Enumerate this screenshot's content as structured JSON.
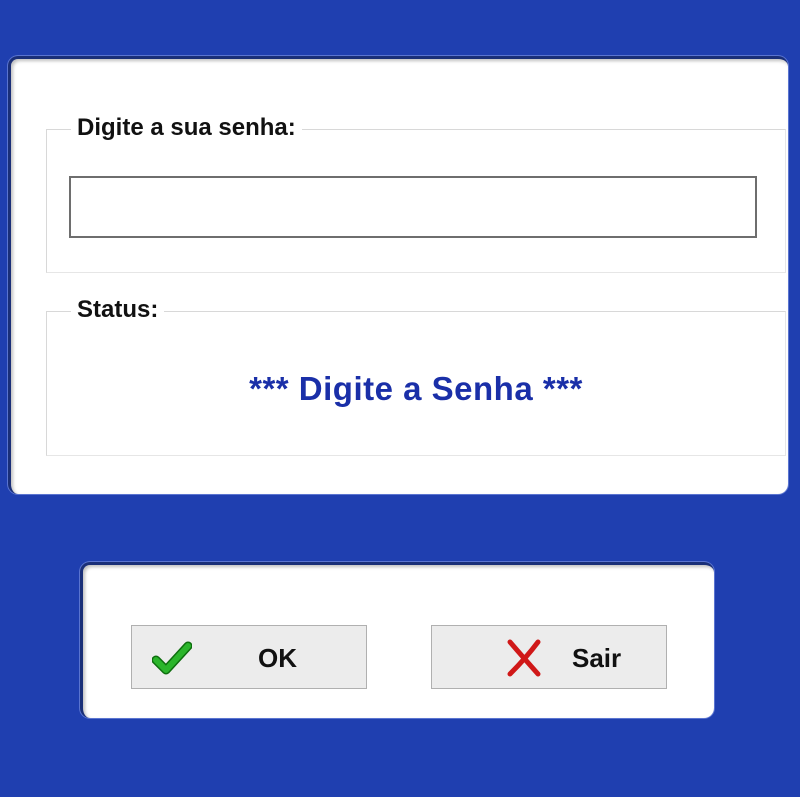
{
  "password_group": {
    "legend": "Digite a sua senha:",
    "input_value": "",
    "input_placeholder": ""
  },
  "status_group": {
    "legend": "Status:",
    "message": "*** Digite a Senha ***"
  },
  "buttons": {
    "ok_label": "OK",
    "sair_label": "Sair"
  },
  "icons": {
    "ok": "check-icon",
    "sair": "close-x-icon"
  },
  "colors": {
    "window_background": "#1f3fb0",
    "status_text": "#1a2fa8",
    "check_green": "#1a9a1a",
    "x_red": "#d01818"
  }
}
